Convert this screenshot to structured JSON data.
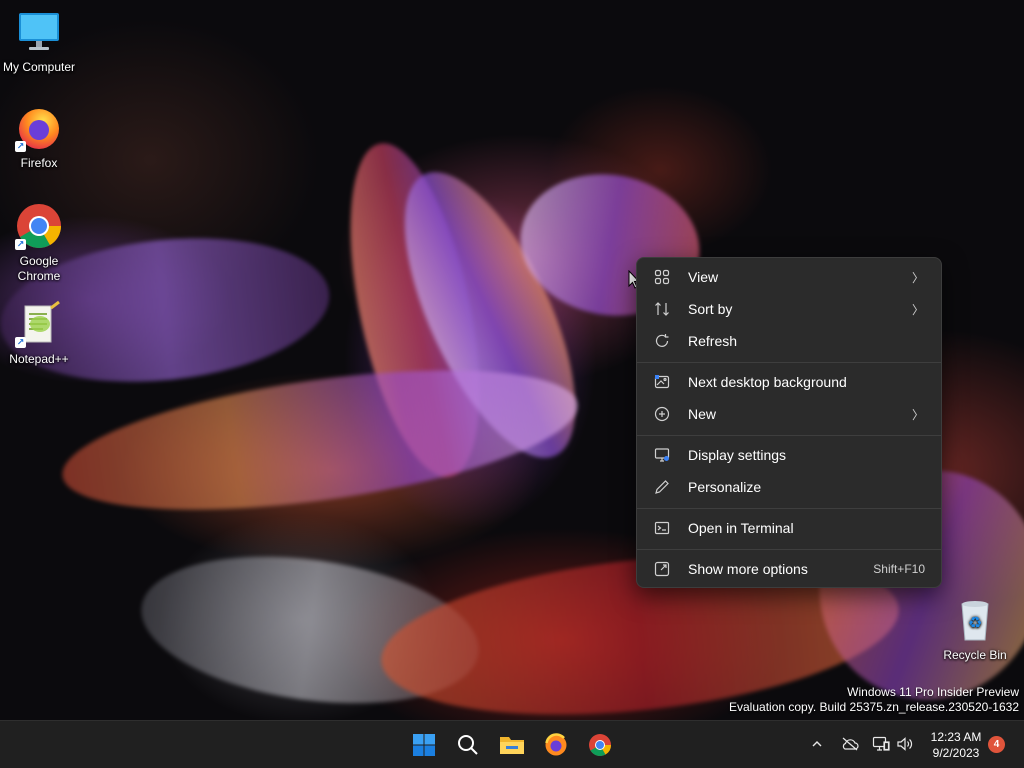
{
  "desktop_icons": [
    {
      "label": "My Computer",
      "icon": "monitor-icon"
    },
    {
      "label": "Firefox",
      "icon": "firefox-icon"
    },
    {
      "label": "Google Chrome",
      "icon": "chrome-icon"
    },
    {
      "label": "Notepad++",
      "icon": "notepadpp-icon"
    },
    {
      "label": "Recycle Bin",
      "icon": "recycle-bin-icon"
    }
  ],
  "context_menu": {
    "items": [
      {
        "label": "View",
        "icon": "grid-icon",
        "submenu": true
      },
      {
        "label": "Sort by",
        "icon": "sort-icon",
        "submenu": true
      },
      {
        "label": "Refresh",
        "icon": "refresh-icon"
      },
      {
        "label": "Next desktop background",
        "icon": "image-next-icon"
      },
      {
        "label": "New",
        "icon": "plus-circle-icon",
        "submenu": true
      },
      {
        "label": "Display settings",
        "icon": "display-settings-icon"
      },
      {
        "label": "Personalize",
        "icon": "pen-icon"
      },
      {
        "label": "Open in Terminal",
        "icon": "terminal-icon"
      },
      {
        "label": "Show more options",
        "icon": "expand-icon",
        "shortcut": "Shift+F10"
      }
    ]
  },
  "watermark": {
    "line1": "Windows 11 Pro Insider Preview",
    "line2": "Evaluation copy. Build 25375.zn_release.230520-1632"
  },
  "taskbar": {
    "apps": [
      "start-icon",
      "search-icon",
      "file-explorer-icon",
      "firefox-icon",
      "chrome-icon"
    ],
    "tray": [
      "chevron-up-icon",
      "cloud-offline-icon",
      "network-icon",
      "volume-icon"
    ],
    "time": "12:23 AM",
    "date": "9/2/2023",
    "notification_count": "4"
  },
  "colors": {
    "menu_bg": "#2b2b2b",
    "taskbar_bg": "#202020",
    "accent": "#0078d4",
    "notification_badge": "#e0543b"
  }
}
